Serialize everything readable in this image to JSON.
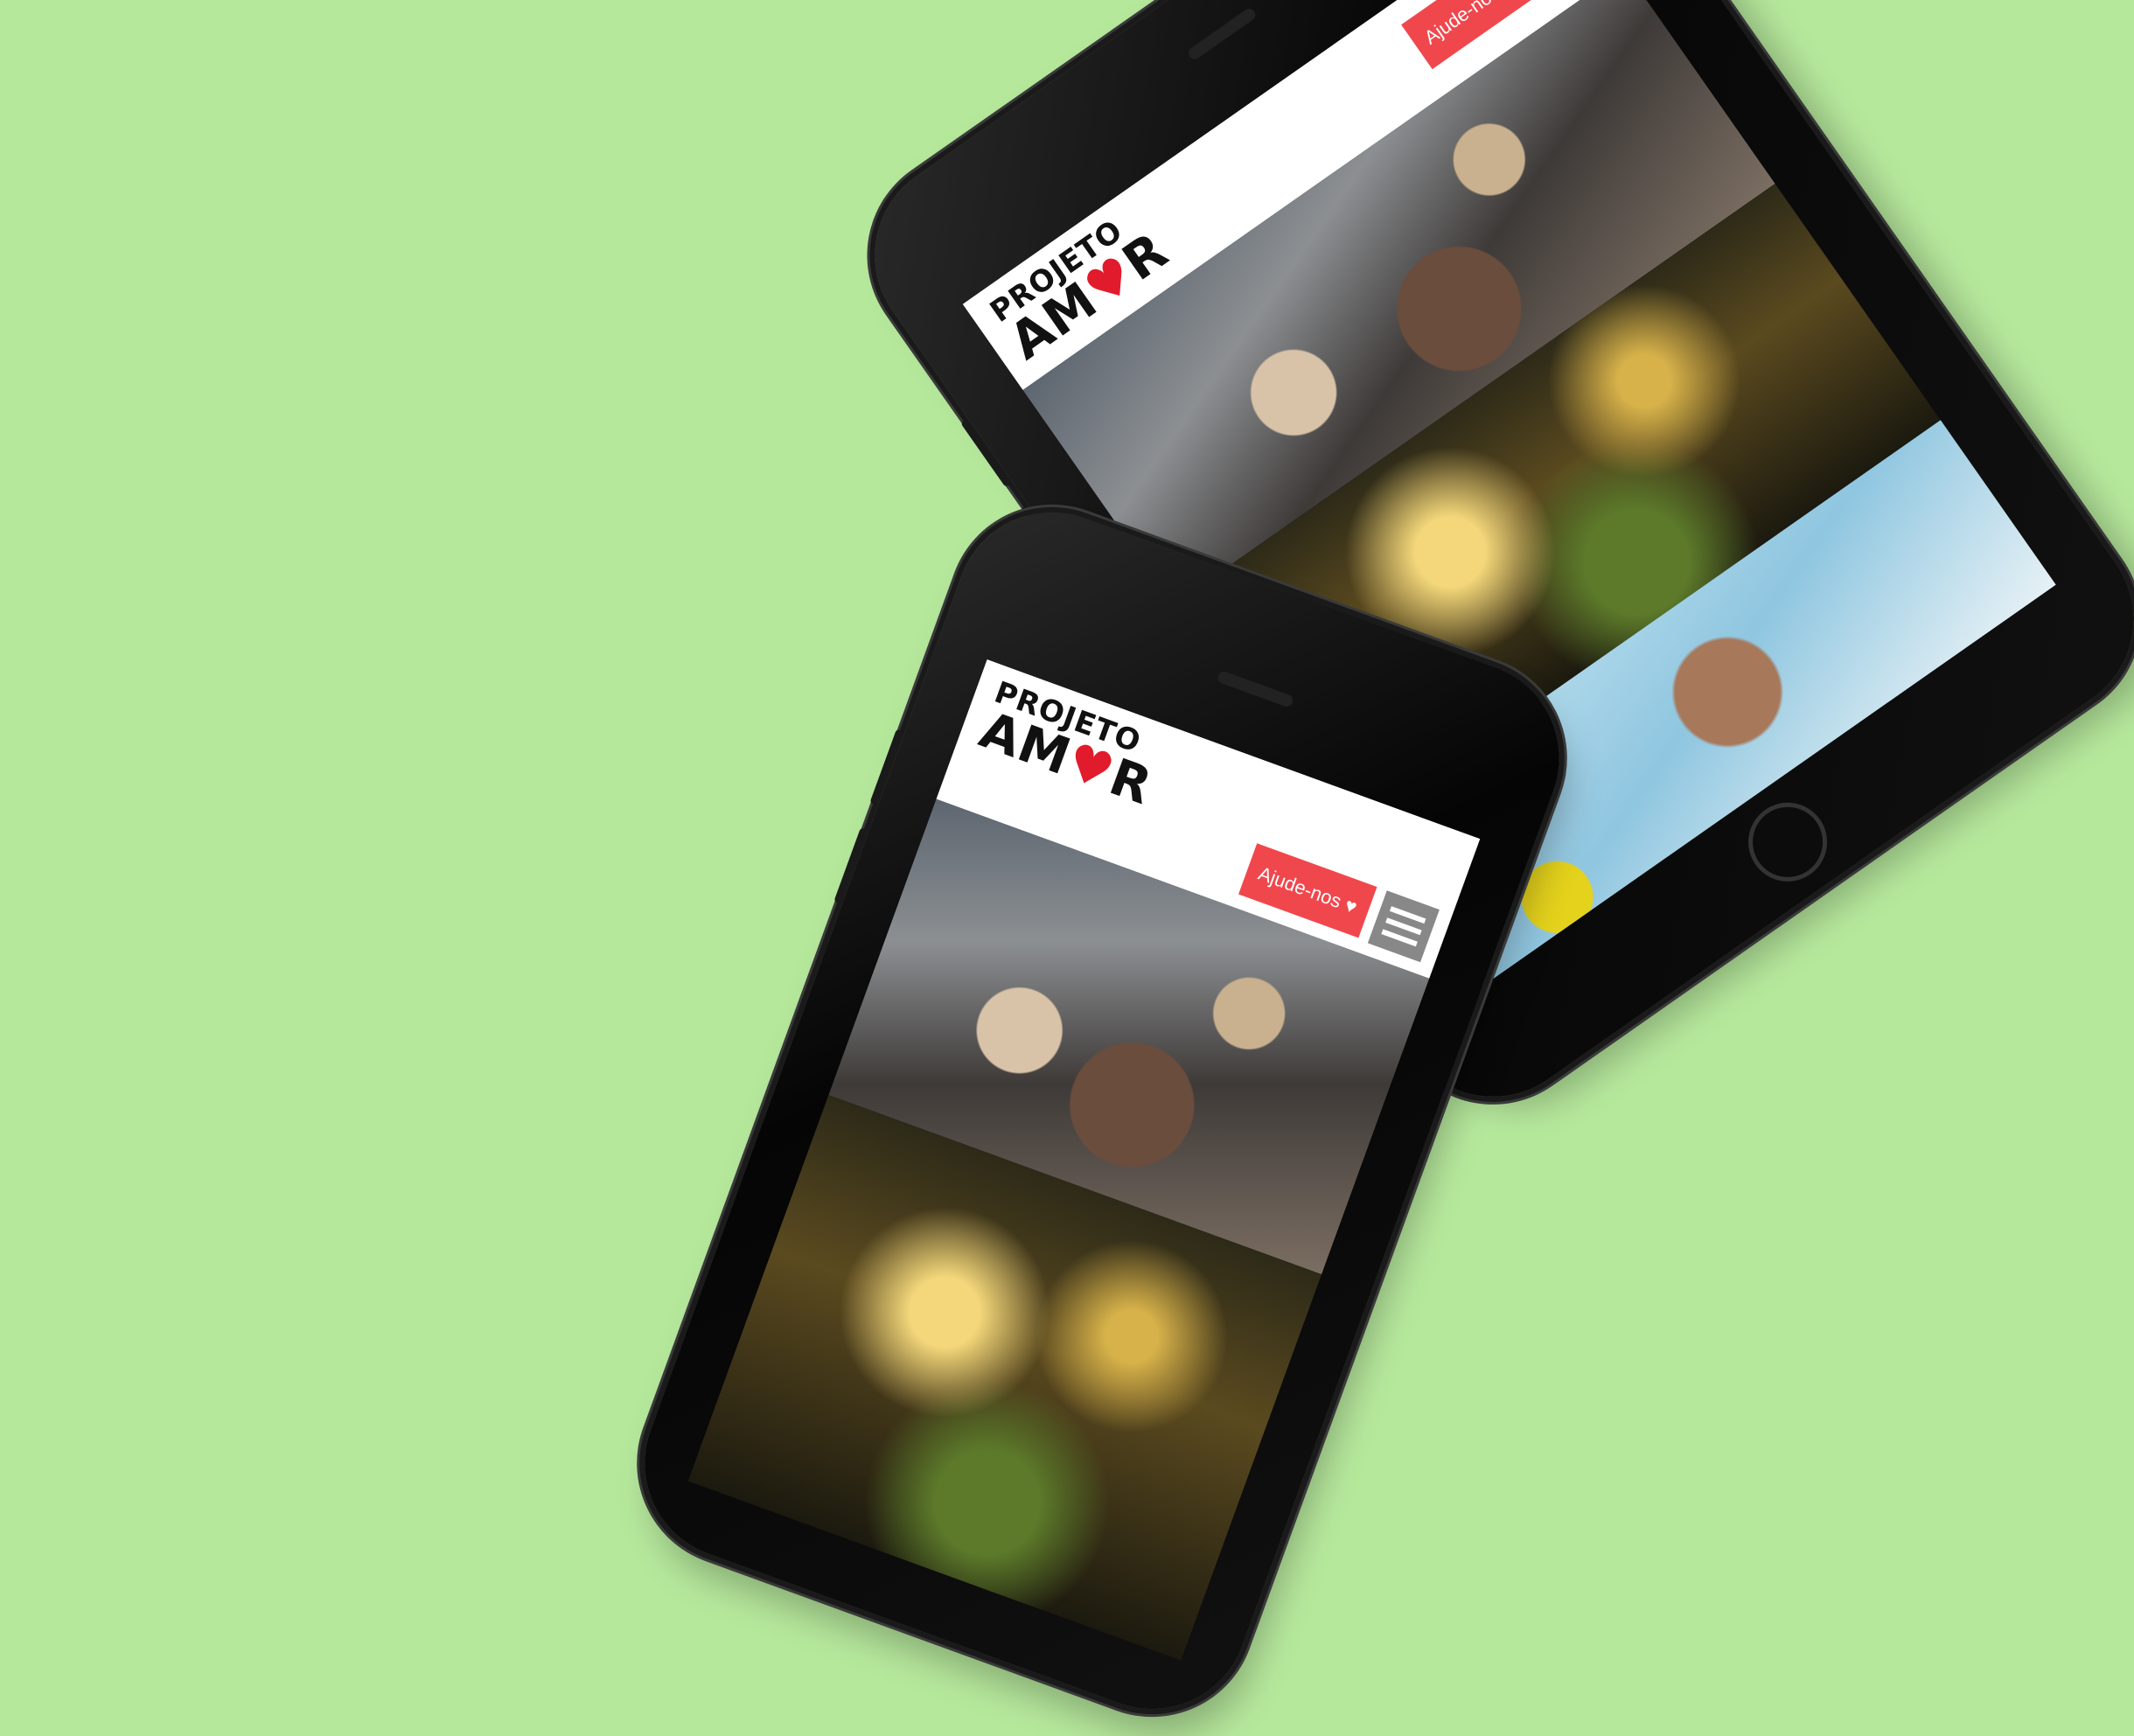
{
  "site": {
    "logo_line1": "PROJETO",
    "logo_line2_a": "AM",
    "logo_line2_heart": "♥",
    "logo_line2_b": "R",
    "help_button": "Ajude-nos ♥",
    "colors": {
      "background": "#b6e89c",
      "accent": "#f0474d",
      "menu": "#888888"
    }
  },
  "icons": {
    "menu": "hamburger-icon",
    "heart": "heart-icon"
  }
}
